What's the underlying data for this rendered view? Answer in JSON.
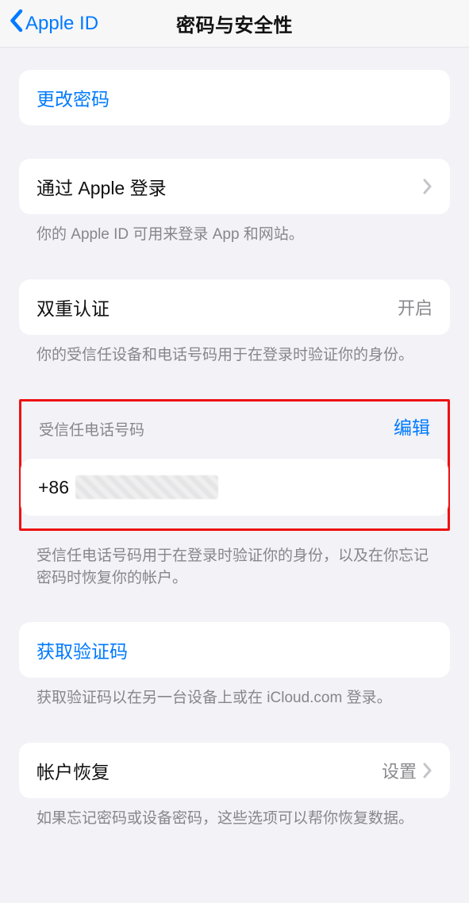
{
  "header": {
    "back_label": "Apple ID",
    "title": "密码与安全性"
  },
  "change_password": {
    "label": "更改密码"
  },
  "sign_in_with_apple": {
    "label": "通过 Apple 登录",
    "footer": "你的 Apple ID 可用来登录 App 和网站。"
  },
  "two_factor": {
    "label": "双重认证",
    "value": "开启",
    "footer": "你的受信任设备和电话号码用于在登录时验证你的身份。"
  },
  "trusted_phone": {
    "section_label": "受信任电话号码",
    "edit_label": "编辑",
    "phone_prefix": "+86",
    "footer": "受信任电话号码用于在登录时验证你的身份，以及在你忘记密码时恢复你的帐户。"
  },
  "get_code": {
    "label": "获取验证码",
    "footer": "获取验证码以在另一台设备上或在 iCloud.com 登录。"
  },
  "account_recovery": {
    "label": "帐户恢复",
    "value": "设置",
    "footer": "如果忘记密码或设备密码，这些选项可以帮你恢复数据。"
  }
}
